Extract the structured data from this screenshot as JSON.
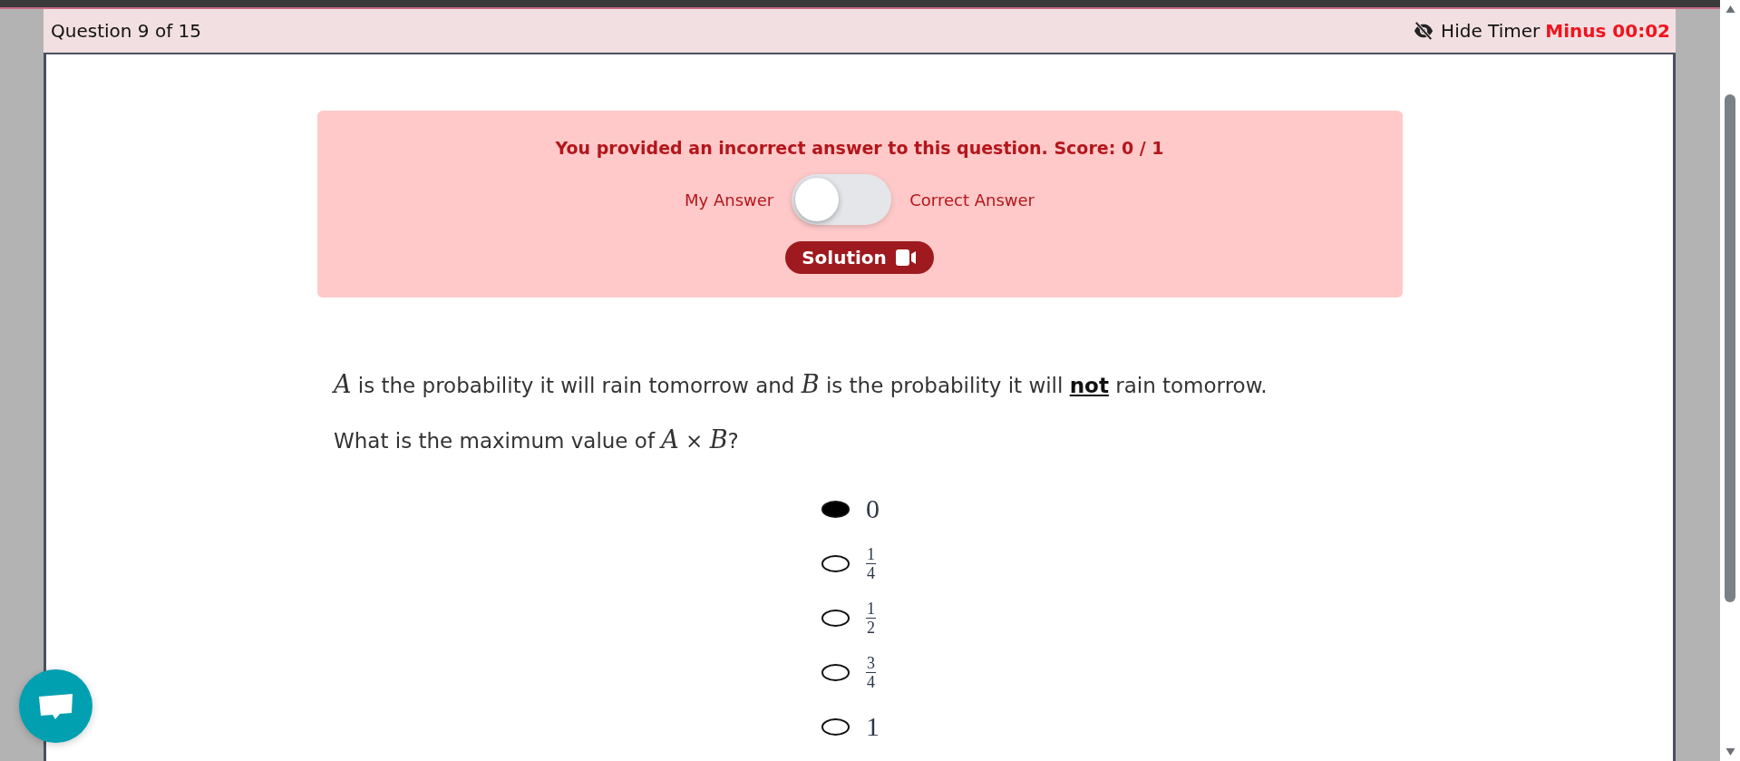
{
  "header": {
    "question_counter": "Question 9 of 15",
    "hide_timer": "Hide Timer",
    "timer": "Minus 00:02"
  },
  "feedback": {
    "message": "You provided an incorrect answer to this question. Score: 0 / 1",
    "left_label": "My Answer",
    "right_label": "Correct Answer",
    "toggle_on": false,
    "solution_button": "Solution"
  },
  "question": {
    "lines": [
      "*A* is the probability it will rain tomorrow and *B* is the probability it will **not** rain tomorrow.",
      "What is the maximum value of *A* × *B*?"
    ]
  },
  "options": [
    {
      "kind": "number",
      "text": "0",
      "selected": true
    },
    {
      "kind": "fraction",
      "numerator": "1",
      "denominator": "4",
      "selected": false
    },
    {
      "kind": "fraction",
      "numerator": "1",
      "denominator": "2",
      "selected": false
    },
    {
      "kind": "fraction",
      "numerator": "3",
      "denominator": "4",
      "selected": false
    },
    {
      "kind": "number",
      "text": "1",
      "selected": false
    }
  ]
}
